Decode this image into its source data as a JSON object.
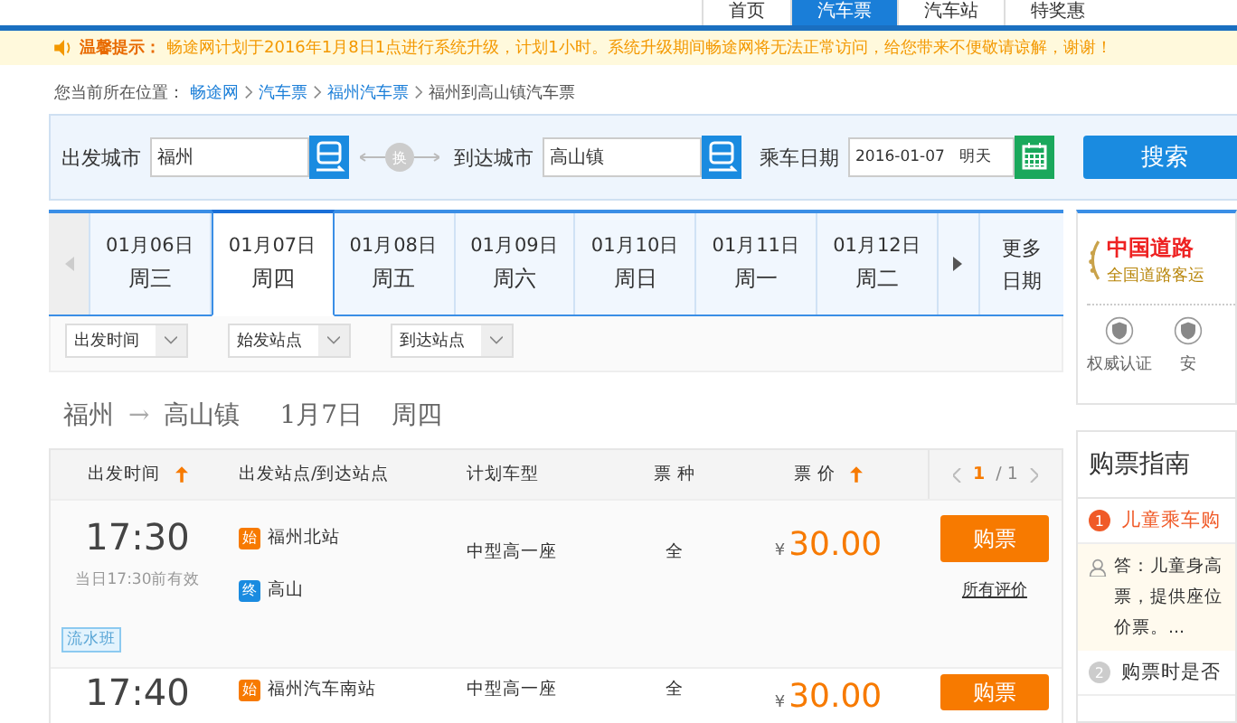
{
  "nav": [
    {
      "label": "首页",
      "selected": false
    },
    {
      "label": "汽车票",
      "selected": true
    },
    {
      "label": "汽车站",
      "selected": false
    },
    {
      "label": "特奖惠",
      "selected": false
    }
  ],
  "notice": {
    "label": "温馨提示：",
    "text": "畅途网计划于2016年1月8日1点进行系统升级，计划1小时。系统升级期间畅途网将无法正常访问，给您带来不便敬请谅解，谢谢！"
  },
  "breadcrumb": {
    "prefix": "您当前所在位置：",
    "links": [
      "畅途网",
      "汽车票",
      "福州汽车票"
    ],
    "current": "福州到高山镇汽车票"
  },
  "search": {
    "from_label": "出发城市",
    "from_value": "福州",
    "swap": "换",
    "to_label": "到达城市",
    "to_value": "高山镇",
    "date_label": "乘车日期",
    "date_value": "2016-01-07",
    "date_note": "明天",
    "button": "搜索"
  },
  "dates": [
    {
      "date": "01月06日",
      "weekday": "周三",
      "selected": false
    },
    {
      "date": "01月07日",
      "weekday": "周四",
      "selected": true
    },
    {
      "date": "01月08日",
      "weekday": "周五",
      "selected": false
    },
    {
      "date": "01月09日",
      "weekday": "周六",
      "selected": false
    },
    {
      "date": "01月10日",
      "weekday": "周日",
      "selected": false
    },
    {
      "date": "01月11日",
      "weekday": "周一",
      "selected": false
    },
    {
      "date": "01月12日",
      "weekday": "周二",
      "selected": false
    }
  ],
  "more_dates": [
    "更多",
    "日期"
  ],
  "filters": [
    "出发时间",
    "始发站点",
    "到达站点"
  ],
  "route": {
    "from": "福州",
    "arrow": "→",
    "to": "高山镇",
    "date": "1月7日",
    "weekday": "周四"
  },
  "table": {
    "columns": [
      {
        "label": "出发时间",
        "sortable": true
      },
      {
        "label": "出发站点/到达站点",
        "sortable": false
      },
      {
        "label": "计划车型",
        "sortable": false
      },
      {
        "label": "票 种",
        "sortable": false
      },
      {
        "label": "票 价",
        "sortable": true
      }
    ],
    "pager": {
      "current": "1",
      "total": "/ 1"
    },
    "rows": [
      {
        "time": "17:30",
        "valid_note": "当日17:30前有效",
        "from_badge": "始",
        "from": "福州北站",
        "to_badge": "终",
        "to": "高山",
        "bus_type": "中型高一座",
        "ticket_type": "全",
        "currency": "¥",
        "price": "30.00",
        "button": "购票",
        "review_link": "所有评价",
        "tag": "流水班"
      },
      {
        "time": "17:40",
        "from_badge": "始",
        "from": "福州汽车南站",
        "bus_type": "中型高一座",
        "ticket_type": "全",
        "currency": "¥",
        "price": "30.00",
        "button": "购票"
      }
    ]
  },
  "certification": {
    "title": "中国道路",
    "subtitle": "全国道路客运",
    "items": [
      "权威认证",
      "安"
    ]
  },
  "guide": {
    "title": "购票指南",
    "items": [
      {
        "number": "1",
        "question": "儿童乘车购",
        "expanded": true,
        "answer": [
          "答：儿童身高",
          "票，提供座位",
          "价票。..."
        ]
      },
      {
        "number": "2",
        "question": "购票时是否",
        "expanded": false
      }
    ]
  }
}
